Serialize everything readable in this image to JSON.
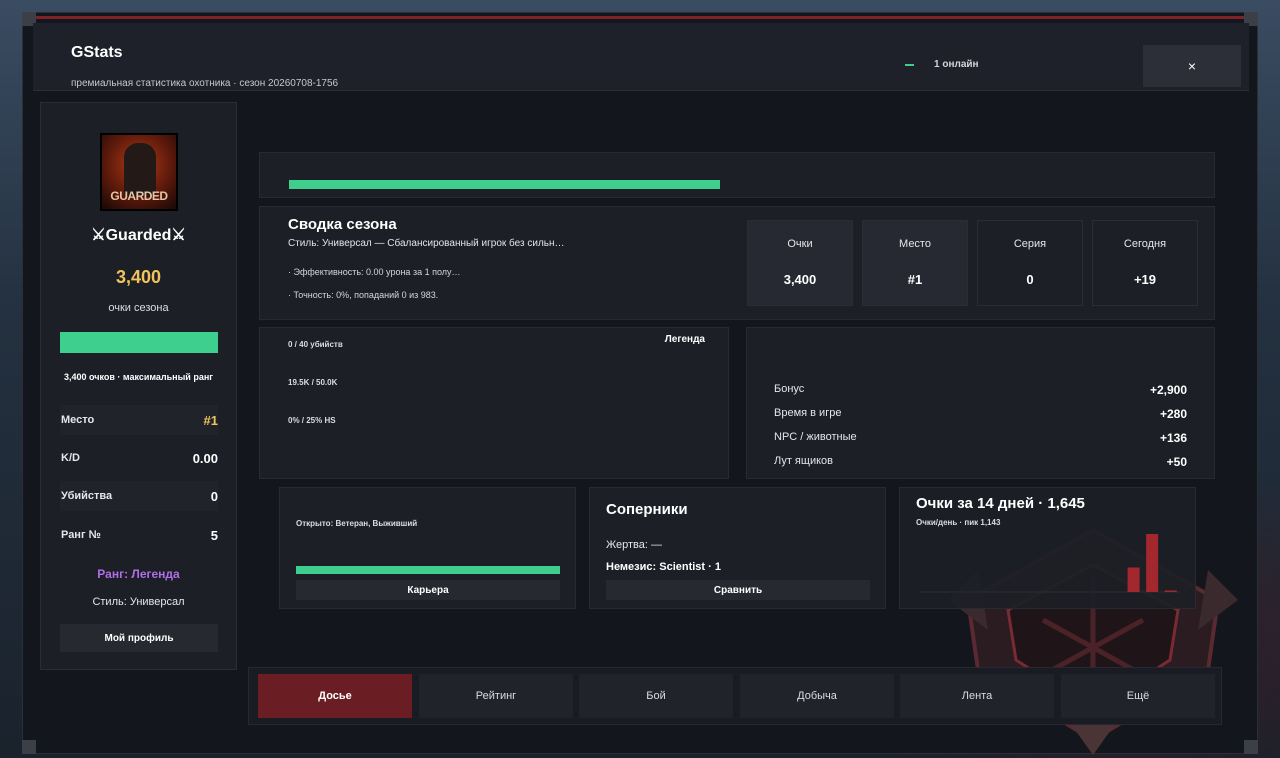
{
  "header": {
    "title": "GStats",
    "subtitle": "премиальная статистика охотника · сезон 20260708-1756",
    "online": "1 онлайн",
    "close_label": "×"
  },
  "profile": {
    "avatar_text": "GUARDED",
    "name": "⚔Guarded⚔",
    "points": "3,400",
    "points_label": "очки сезона",
    "points_progress": 1.0,
    "rank_progress_text": "3,400 очков · максимальный ранг",
    "stats": [
      {
        "label": "Место",
        "value": "#1"
      },
      {
        "label": "K/D",
        "value": "0.00"
      },
      {
        "label": "Убийства",
        "value": "0"
      },
      {
        "label": "Ранг №",
        "value": "5"
      }
    ],
    "rank": "Ранг: Легенда",
    "style": "Стиль: Универсал",
    "profile_button": "Мой профиль"
  },
  "season_progress": 0.46,
  "summary": {
    "title": "Сводка сезона",
    "style": "Стиль: Универсал — Сбалансированный игрок без сильн…",
    "line1": "· Эффективность: 0.00 урона за 1 полу…",
    "line2": "· Точность: 0%, попаданий 0 из 983.",
    "tiles": [
      {
        "label": "Очки",
        "value": "3,400"
      },
      {
        "label": "Место",
        "value": "#1"
      },
      {
        "label": "Серия",
        "value": "0"
      },
      {
        "label": "Сегодня",
        "value": "+19"
      }
    ]
  },
  "goals": {
    "badge": "Легенда",
    "items": [
      "0 / 40 убийств",
      "19.5K / 50.0K",
      "0% / 25% HS"
    ]
  },
  "bonus": {
    "rows": [
      {
        "label": "Бонус",
        "value": "+2,900"
      },
      {
        "label": "Время в игре",
        "value": "+280"
      },
      {
        "label": "NPC / животные",
        "value": "+136"
      },
      {
        "label": "Лут ящиков",
        "value": "+50"
      }
    ]
  },
  "career": {
    "opened": "Открыто: Ветеран, Выживший",
    "progress": 1.0,
    "button": "Карьера"
  },
  "rivals": {
    "title": "Соперники",
    "victim": "Жертва: —",
    "nemesis": "Немезис: Scientist · 1",
    "button": "Сравнить"
  },
  "chart": {
    "title": "Очки за 14 дней · 1,645",
    "subtitle": "Очки/день · пик 1,143"
  },
  "chart_data": {
    "type": "bar",
    "title": "Очки за 14 дней · 1,645",
    "subtitle": "Очки/день · пик 1,143",
    "values": [
      0,
      0,
      0,
      0,
      0,
      0,
      0,
      0,
      0,
      0,
      0,
      483,
      1143,
      19
    ],
    "ylim": [
      0,
      1143
    ],
    "bar_color": "#a3282e"
  },
  "tabs": [
    {
      "label": "Досье",
      "active": true
    },
    {
      "label": "Рейтинг",
      "active": false
    },
    {
      "label": "Бой",
      "active": false
    },
    {
      "label": "Добыча",
      "active": false
    },
    {
      "label": "Лента",
      "active": false
    },
    {
      "label": "Ещё",
      "active": false
    }
  ],
  "colors": {
    "accent_green": "#3ecf8e",
    "gold": "#f0c45c",
    "rank_purple": "#b06ee8",
    "active_tab": "#6a1d22"
  }
}
